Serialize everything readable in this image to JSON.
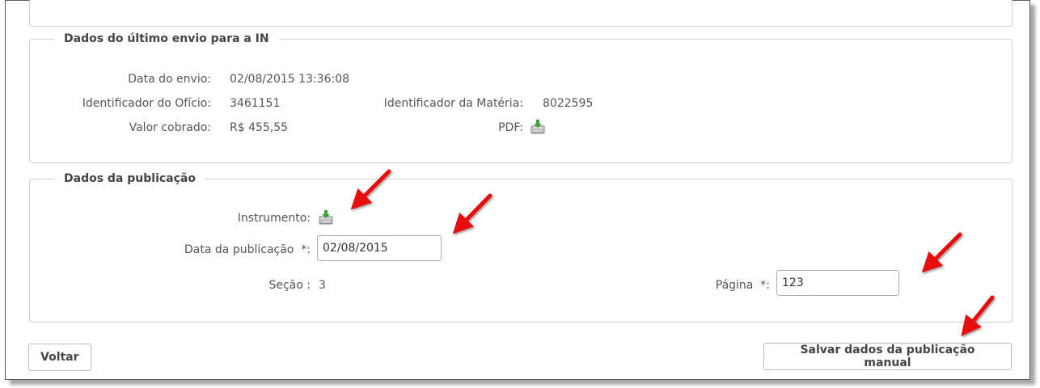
{
  "envio": {
    "legend": "Dados do último envio para a IN",
    "data_envio_label": "Data do envio:",
    "data_envio_value": "02/08/2015 13:36:08",
    "id_oficio_label": "Identificador do Ofício:",
    "id_oficio_value": "3461151",
    "id_materia_label": "Identificador da Matéria:",
    "id_materia_value": "8022595",
    "valor_label": "Valor cobrado:",
    "valor_value": "R$ 455,55",
    "pdf_label": "PDF:",
    "pdf_icon": "print-download-icon"
  },
  "publicacao": {
    "legend": "Dados da publicação",
    "instrumento_label": "Instrumento:",
    "instrumento_icon": "print-download-icon",
    "data_label": "Data da publicação  *:",
    "data_value": "02/08/2015",
    "secao_label": "Seção :",
    "secao_value": "3",
    "pagina_label": "Página  *:",
    "pagina_value": "123"
  },
  "actions": {
    "back_label": "Voltar",
    "save_label": "Salvar dados da publicação manual"
  },
  "colors": {
    "annotation_arrow": "#e8100f",
    "border": "#cfcfcf",
    "text": "#555555"
  }
}
